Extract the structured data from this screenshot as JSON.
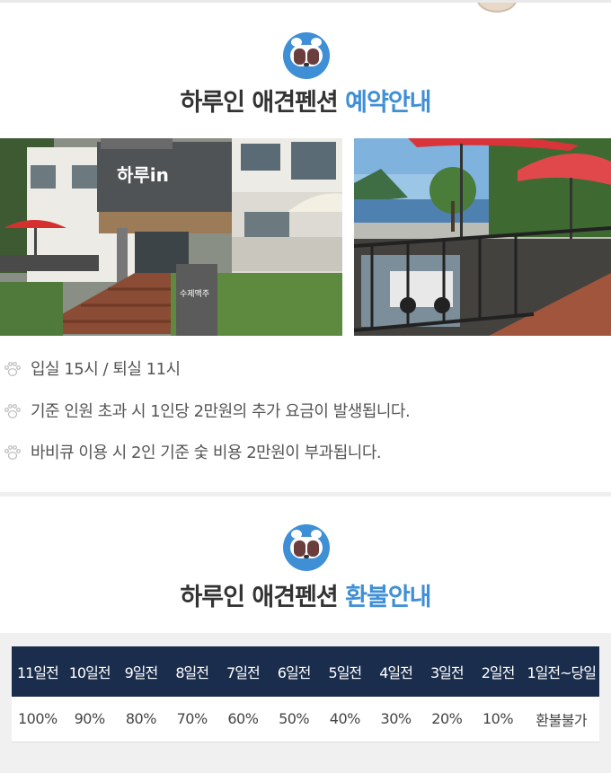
{
  "reservation": {
    "title_main": "하루인 애견펜션",
    "title_accent": "예약안내",
    "photo_sign_brand": "하루in",
    "photo_sign_board": "수제맥주",
    "notices": [
      "입실 15시 / 퇴실 11시",
      "기준 인원 초과 시 1인당 2만원의 추가 요금이 발생됩니다.",
      "바비큐 이용 시 2인 기준 숯 비용 2만원이 부과됩니다."
    ]
  },
  "refund": {
    "title_main": "하루인 애견펜션",
    "title_accent": "환불안내",
    "headers": [
      "11일전",
      "10일전",
      "9일전",
      "8일전",
      "7일전",
      "6일전",
      "5일전",
      "4일전",
      "3일전",
      "2일전",
      "1일전~당일"
    ],
    "values": [
      "100%",
      "90%",
      "80%",
      "70%",
      "60%",
      "50%",
      "40%",
      "30%",
      "20%",
      "10%",
      "환불불가"
    ]
  },
  "colors": {
    "accent": "#3f8fd6",
    "table_header": "#1b2d4c",
    "text": "#333333"
  },
  "icons": {
    "logo": "dog-face-logo-icon",
    "bullet": "paw-icon"
  }
}
